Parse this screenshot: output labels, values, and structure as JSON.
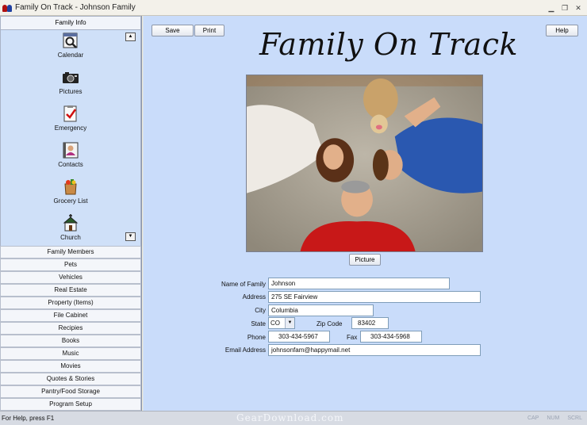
{
  "window": {
    "title": "Family On Track - Johnson Family",
    "controls": {
      "minimize": "▁",
      "restore": "❐",
      "close": "✕"
    }
  },
  "sidebar": {
    "header": "Family Info",
    "items": [
      {
        "label": "Calendar",
        "icon": "calendar-icon"
      },
      {
        "label": "Pictures",
        "icon": "camera-icon"
      },
      {
        "label": "Emergency",
        "icon": "emergency-icon"
      },
      {
        "label": "Contacts",
        "icon": "contacts-icon"
      },
      {
        "label": "Grocery List",
        "icon": "grocery-icon"
      },
      {
        "label": "Church",
        "icon": "church-icon"
      }
    ],
    "scroll_up": "▲",
    "scroll_down": "▼",
    "sections": [
      "Family Members",
      "Pets",
      "Vehicles",
      "Real Estate",
      "Property (Items)",
      "File Cabinet",
      "Recipies",
      "Books",
      "Music",
      "Movies",
      "Quotes & Stories",
      "Pantry/Food Storage",
      "Program Setup"
    ]
  },
  "toolbar": {
    "save": "Save",
    "print": "Print",
    "help": "Help"
  },
  "main": {
    "title": "Family On Track",
    "picture_button": "Picture"
  },
  "form": {
    "name_label": "Name of Family",
    "name": "Johnson",
    "address_label": "Address",
    "address": "275 SE Fairview",
    "city_label": "City",
    "city": "Columbia",
    "state_label": "State",
    "state": "CO",
    "zip_label": "Zip Code",
    "zip": "83402",
    "phone_label": "Phone",
    "phone": "303-434-5967",
    "fax_label": "Fax",
    "fax": "303-434-5968",
    "email_label": "Email Address",
    "email": "johnsonfam@happymail.net"
  },
  "statusbar": {
    "text": "For Help, press F1",
    "watermark": "GearDownload.com",
    "indicators": [
      "CAP",
      "NUM",
      "SCRL"
    ]
  },
  "colors": {
    "main_bg": "#c9dcfa",
    "sidebar_panel": "#cfe0f8",
    "shirt_red": "#c81818"
  }
}
